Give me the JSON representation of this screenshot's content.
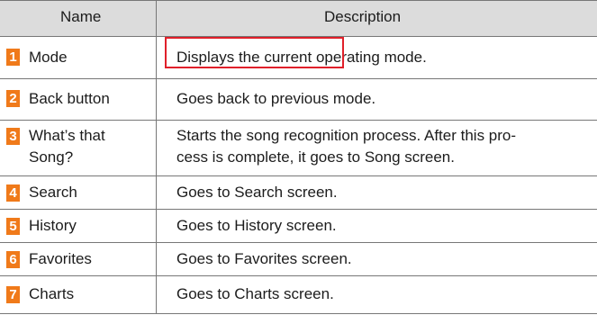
{
  "header": {
    "name": "Name",
    "description": "Description"
  },
  "rows": [
    {
      "number": "1",
      "name_lines": [
        "Mode"
      ],
      "desc_parts": [
        "Displays the current",
        " operating mode."
      ]
    },
    {
      "number": "2",
      "name_lines": [
        "Back button"
      ],
      "desc_lines": [
        "Goes back to previous mode."
      ]
    },
    {
      "number": "3",
      "name_lines": [
        "What’s that",
        "Song?"
      ],
      "desc_lines": [
        "Starts the song recognition process. After this pro-",
        "cess is complete, it goes to Song screen."
      ]
    },
    {
      "number": "4",
      "name_lines": [
        "Search"
      ],
      "desc_lines": [
        "Goes to Search screen."
      ]
    },
    {
      "number": "5",
      "name_lines": [
        "History"
      ],
      "desc_lines": [
        "Goes to History screen."
      ]
    },
    {
      "number": "6",
      "name_lines": [
        "Favorites"
      ],
      "desc_lines": [
        "Goes to Favorites screen."
      ]
    },
    {
      "number": "7",
      "name_lines": [
        "Charts"
      ],
      "desc_lines": [
        "Goes to Charts screen."
      ]
    }
  ],
  "colors": {
    "badge": "#f07a1a",
    "highlight": "#e0202a",
    "header_bg": "#dcdcdc",
    "grid": "#777777"
  }
}
